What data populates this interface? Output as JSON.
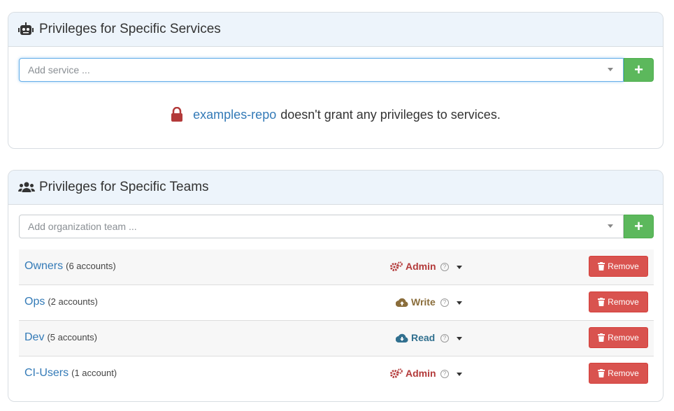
{
  "services_panel": {
    "title": "Privileges for Specific Services",
    "icon": "robot-icon",
    "add_placeholder": "Add service ...",
    "add_button": "+",
    "empty_repo": "examples-repo",
    "empty_text": "doesn't grant any privileges to services."
  },
  "teams_panel": {
    "title": "Privileges for Specific Teams",
    "icon": "users-icon",
    "add_placeholder": "Add organization team ...",
    "add_button": "+",
    "remove_label": "Remove",
    "help_glyph": "?",
    "teams": [
      {
        "name": "Owners",
        "count": "(6 accounts)",
        "role": "Admin",
        "role_icon": "cogs-icon"
      },
      {
        "name": "Ops",
        "count": "(2 accounts)",
        "role": "Write",
        "role_icon": "cloud-upload-icon"
      },
      {
        "name": "Dev",
        "count": "(5 accounts)",
        "role": "Read",
        "role_icon": "cloud-download-icon"
      },
      {
        "name": "CI-Users",
        "count": "(1 account)",
        "role": "Admin",
        "role_icon": "cogs-icon"
      }
    ]
  },
  "colors": {
    "admin": "#b33a3a",
    "write": "#8a6d3b",
    "read": "#31708f",
    "add_button": "#5cb85c",
    "remove_button": "#d9534f",
    "link": "#337ab7"
  }
}
